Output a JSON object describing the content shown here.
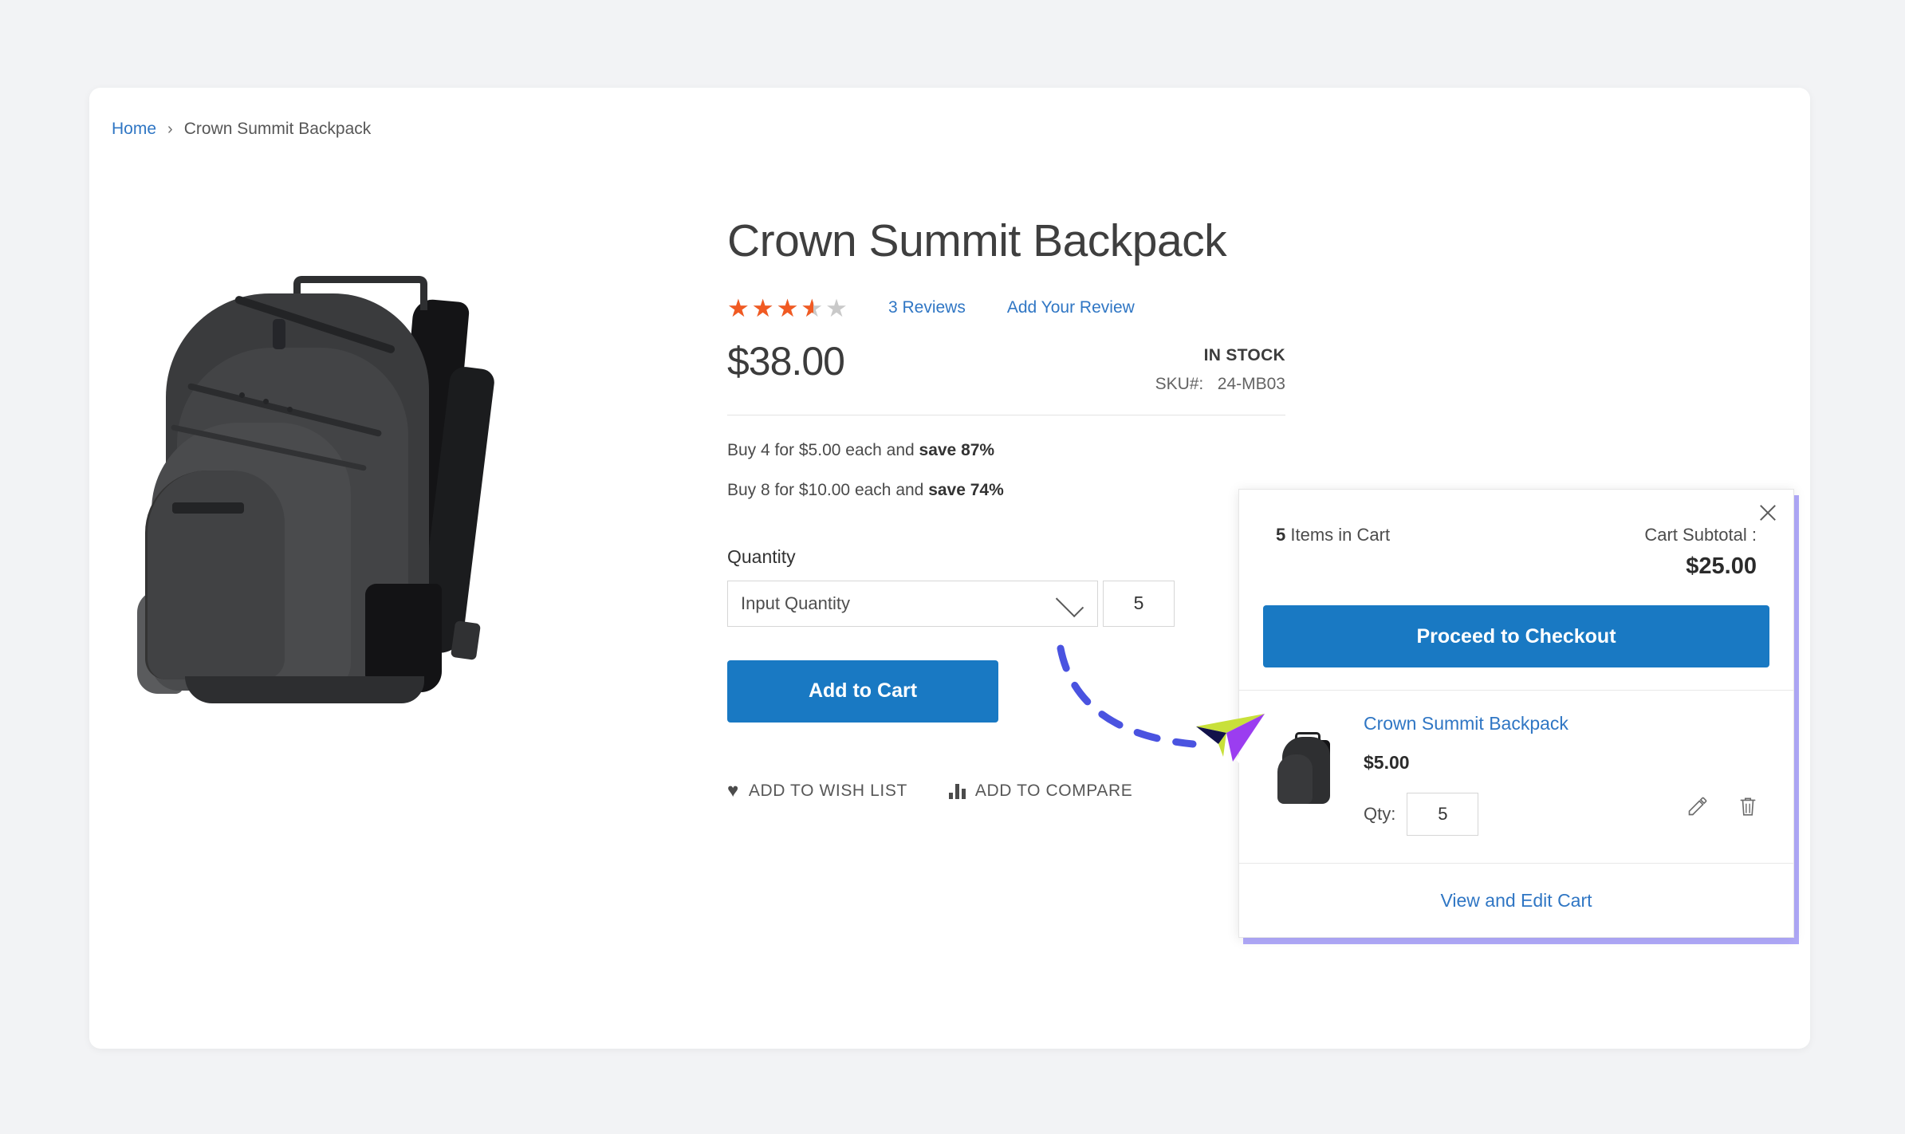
{
  "breadcrumb": {
    "home": "Home",
    "separator": "›",
    "current": "Crown Summit Backpack"
  },
  "product": {
    "title": "Crown Summit Backpack",
    "rating_stars_filled": "★★★★★",
    "rating_stars_empty": "★★★★★",
    "rating_percent": "70%",
    "reviews_link": "3  Reviews",
    "add_review_link": "Add Your Review",
    "price": "$38.00",
    "stock_status": "IN STOCK",
    "sku_label": "SKU#:",
    "sku_value": "24-MB03",
    "tier_price_1_prefix": "Buy 4 for $5.00 each and ",
    "tier_price_1_bold": "save 87%",
    "tier_price_2_prefix": "Buy 8 for $10.00 each and ",
    "tier_price_2_bold": "save 74%",
    "quantity_label": "Quantity",
    "quantity_select_value": "Input Quantity",
    "quantity_value": "5",
    "add_to_cart_label": "Add to Cart",
    "wishlist_label": "ADD TO WISH LIST",
    "compare_label": "ADD TO COMPARE",
    "image_alt": "Crown Summit Backpack"
  },
  "minicart": {
    "items_count": "5",
    "items_label": " Items in Cart",
    "subtotal_label": "Cart Subtotal :",
    "subtotal_value": "$25.00",
    "checkout_label": "Proceed to Checkout",
    "item": {
      "name": "Crown Summit Backpack",
      "price": "$5.00",
      "qty_label": "Qty:",
      "qty_value": "5",
      "edit_icon": "pencil-icon",
      "delete_icon": "trash-icon"
    },
    "view_edit_cart_label": "View and Edit Cart",
    "close_icon": "close-icon"
  },
  "colors": {
    "accent_blue": "#1979c3",
    "link_blue": "#2f76c4",
    "star_orange": "#f15a22",
    "star_gray": "#c9c9c9",
    "panel_glow": "#6e60f0",
    "page_bg": "#f2f3f5"
  },
  "annotation": {
    "trail_color": "#4a53e0",
    "cursor_name": "paper-plane-cursor"
  }
}
